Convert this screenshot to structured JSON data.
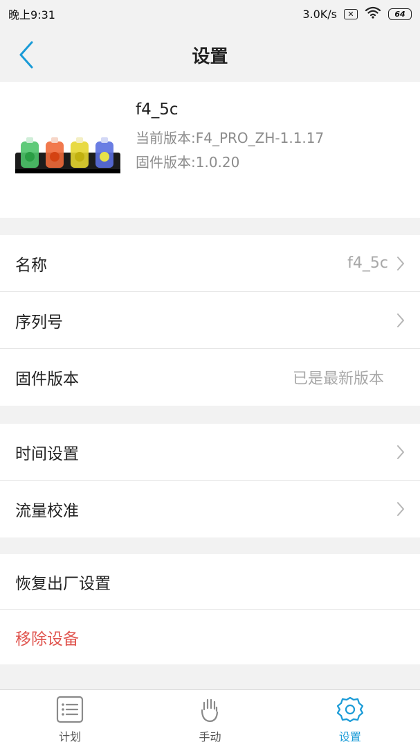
{
  "status_bar": {
    "time": "晚上9:31",
    "speed": "3.0K/s",
    "sim_icon_text": "✕",
    "battery": "64"
  },
  "nav": {
    "title": "设置",
    "back_icon": "chevron-left-icon",
    "accent_color": "#1a9bd7"
  },
  "device": {
    "name": "f4_5c",
    "current_version": "当前版本:F4_PRO_ZH-1.1.17",
    "firmware_version": "固件版本:1.0.20"
  },
  "settings": {
    "group1": [
      {
        "label": "名称",
        "value": "f4_5c",
        "chevron": true
      },
      {
        "label": "序列号",
        "value": "",
        "chevron": true
      },
      {
        "label": "固件版本",
        "value": "已是最新版本",
        "chevron": false
      }
    ],
    "group2": [
      {
        "label": "时间设置",
        "chevron": true
      },
      {
        "label": "流量校准",
        "chevron": true
      }
    ],
    "group3": [
      {
        "label": "恢复出厂设置"
      },
      {
        "label": "移除设备",
        "color": "#e0554f"
      }
    ]
  },
  "tabs": [
    {
      "label": "计划",
      "icon": "list-icon",
      "active": false
    },
    {
      "label": "手动",
      "icon": "hand-icon",
      "active": false
    },
    {
      "label": "设置",
      "icon": "gear-icon",
      "active": true
    }
  ]
}
